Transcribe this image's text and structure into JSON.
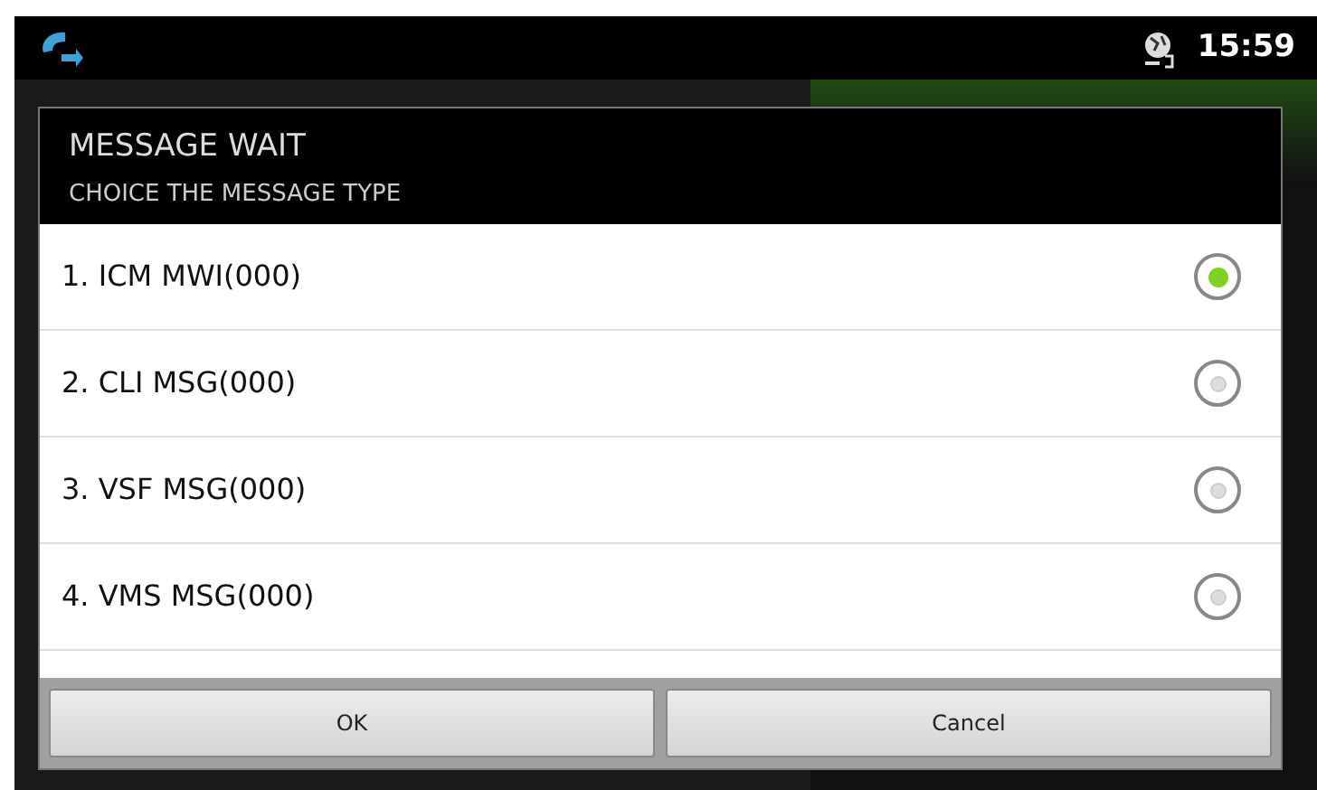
{
  "status_bar": {
    "time": "15:59"
  },
  "dialog": {
    "title": "MESSAGE WAIT",
    "subtitle": "CHOICE THE MESSAGE TYPE",
    "options": [
      {
        "label": "1. ICM MWI(000)",
        "selected": true
      },
      {
        "label": "2. CLI MSG(000)",
        "selected": false
      },
      {
        "label": "3. VSF MSG(000)",
        "selected": false
      },
      {
        "label": "4. VMS MSG(000)",
        "selected": false
      }
    ],
    "buttons": [
      "OK",
      "Cancel"
    ]
  }
}
